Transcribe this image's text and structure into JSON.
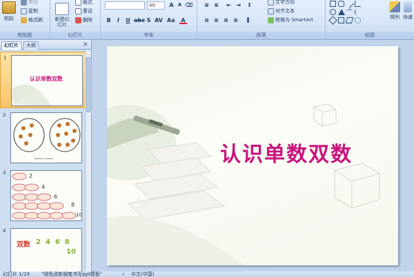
{
  "ribbon": {
    "clipboard": {
      "paste_label": "粘贴",
      "copy_label": "复制",
      "format_painter_label": "格式刷",
      "cut_label": "剪切",
      "group_label": "剪贴板"
    },
    "slides": {
      "new_slide_label": "新建幻灯片",
      "layout_label": "版式",
      "reset_label": "重设",
      "delete_label": "删除",
      "group_label": "幻灯片"
    },
    "font": {
      "font_name": "",
      "font_size": "40",
      "group_label": "字体"
    },
    "paragraph": {
      "text_direction_label": "文字方向",
      "align_text_label": "对齐文本",
      "smartart_label": "转换为 SmartArt",
      "group_label": "段落"
    },
    "drawing": {
      "arrange_label": "排列",
      "quick_styles_label": "快速",
      "group_label": "绘图"
    }
  },
  "left_panel": {
    "tab_slides": "幻灯片",
    "tab_outline": "大纲",
    "close": "×",
    "thumbnails": [
      {
        "number": "1",
        "title": "认识单数双数"
      },
      {
        "number": "2",
        "caption": "Шашки и шашки"
      },
      {
        "number": "3",
        "labels": [
          "2",
          "4",
          "6",
          "8",
          "10"
        ]
      },
      {
        "number": "4",
        "word": "双数",
        "numbers": "2  4  6  8",
        "last": "10"
      }
    ]
  },
  "slide": {
    "title": "认识单数双数"
  },
  "status": {
    "slide_info": "幻灯片 1/19",
    "theme": "\"绿色清新钢笔书写ppt模板\"",
    "language": "中文(中国)"
  },
  "colors": {
    "title": "#c8137e",
    "accent_green": "#8ab034",
    "selected_thumb": "#f8c467"
  }
}
